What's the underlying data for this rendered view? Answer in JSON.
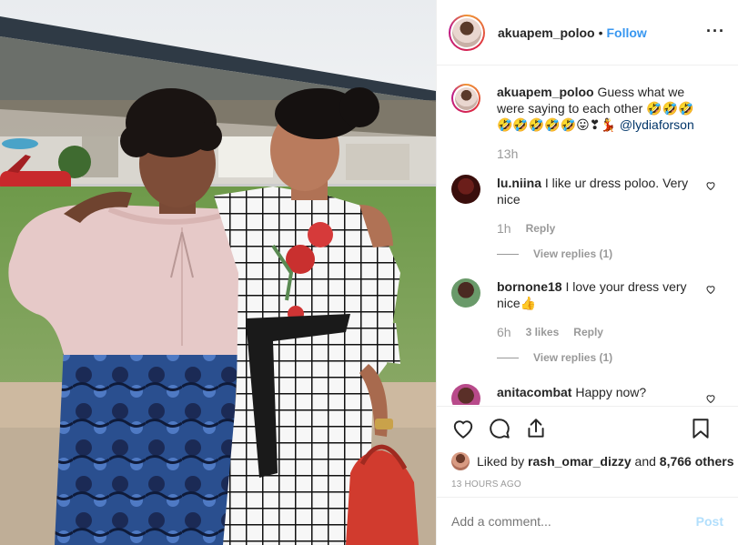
{
  "post": {
    "username": "akuapem_poloo",
    "separator": "•",
    "follow_label": "Follow",
    "more_label": "···"
  },
  "caption": {
    "username": "akuapem_poloo",
    "text": "Guess what we were saying to each other 🤣🤣🤣🤣🤣🤣🤣🤣😛❣💃 ",
    "mention": "@lydiaforson",
    "time": "13h"
  },
  "comments": [
    {
      "username": "lu.niina",
      "text": "I like ur dress poloo. Very nice",
      "time": "1h",
      "likes": "",
      "reply_label": "Reply",
      "view_replies": "View replies (1)"
    },
    {
      "username": "bornone18",
      "text": "I love your dress very nice👍",
      "time": "6h",
      "likes": "3 likes",
      "reply_label": "Reply",
      "view_replies": "View replies (1)"
    },
    {
      "username": "anitacombat",
      "text": "Happy now?"
    }
  ],
  "likes": {
    "prefix": "Liked by ",
    "user": "rash_omar_dizzy",
    "middle": " and ",
    "count": "8,766 others"
  },
  "posted_ago": "13 HOURS AGO",
  "add_comment": {
    "placeholder": "Add a comment...",
    "post_label": "Post"
  },
  "icons": [
    "heart-icon",
    "comment-icon",
    "share-icon",
    "bookmark-icon",
    "more-icon"
  ],
  "colors": {
    "accent": "#3897f0",
    "post_disabled": "#b2dffc",
    "muted": "#999999",
    "border": "#efefef"
  }
}
